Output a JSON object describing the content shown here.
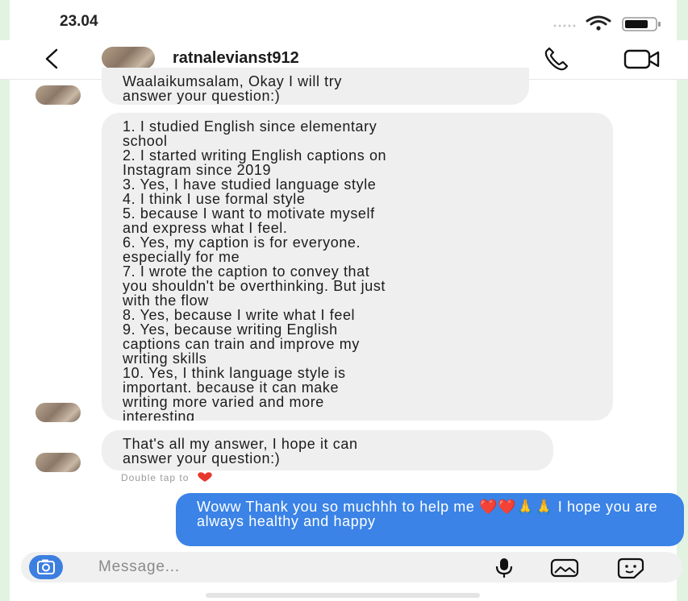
{
  "status_bar": {
    "time": "23.04",
    "icons": [
      "signal-dots-icon",
      "wifi-icon",
      "battery-icon"
    ]
  },
  "header": {
    "username": "ratnalevianst912",
    "icons": [
      "back-arrow-icon",
      "phone-icon",
      "video-camera-icon"
    ]
  },
  "messages": [
    {
      "direction": "incoming",
      "text": "Waalaikumsalam, Okay I will try\nanswer your question:)"
    },
    {
      "direction": "incoming",
      "text": "1. I studied English since elementary\nschool\n2. I started writing English captions on\nInstagram since 2019\n3. Yes, I have studied language style\n4. I think I use formal style\n5. because I want to motivate myself\nand express what I feel.\n6. Yes, my caption is for everyone.\nespecially for me\n7. I wrote the caption to convey that\nyou shouldn't be overthinking. But just\nwith the flow\n8. Yes, because I write what I feel\n9. Yes, because writing English\ncaptions can train and improve my\nwriting skills\n10. Yes, I think language style is\nimportant.  because it can make\nwriting more varied and more\ninteresting"
    },
    {
      "direction": "incoming",
      "text": "That's all my answer, I hope it can\nanswer your question:)"
    },
    {
      "direction": "outgoing",
      "text": "Woww Thank you so muchhh to help\nme ❤️❤️🙏🙏 I hope you are always\nhealthy and happy"
    }
  ],
  "double_tap_hint": "Double tap to",
  "composer": {
    "placeholder": "Message...",
    "icons": [
      "camera-icon",
      "microphone-icon",
      "gallery-icon",
      "sticker-icon"
    ]
  },
  "colors": {
    "outgoing_bubble": "#3b83e6",
    "incoming_bubble": "#efefef",
    "heart": "#e8372e"
  }
}
